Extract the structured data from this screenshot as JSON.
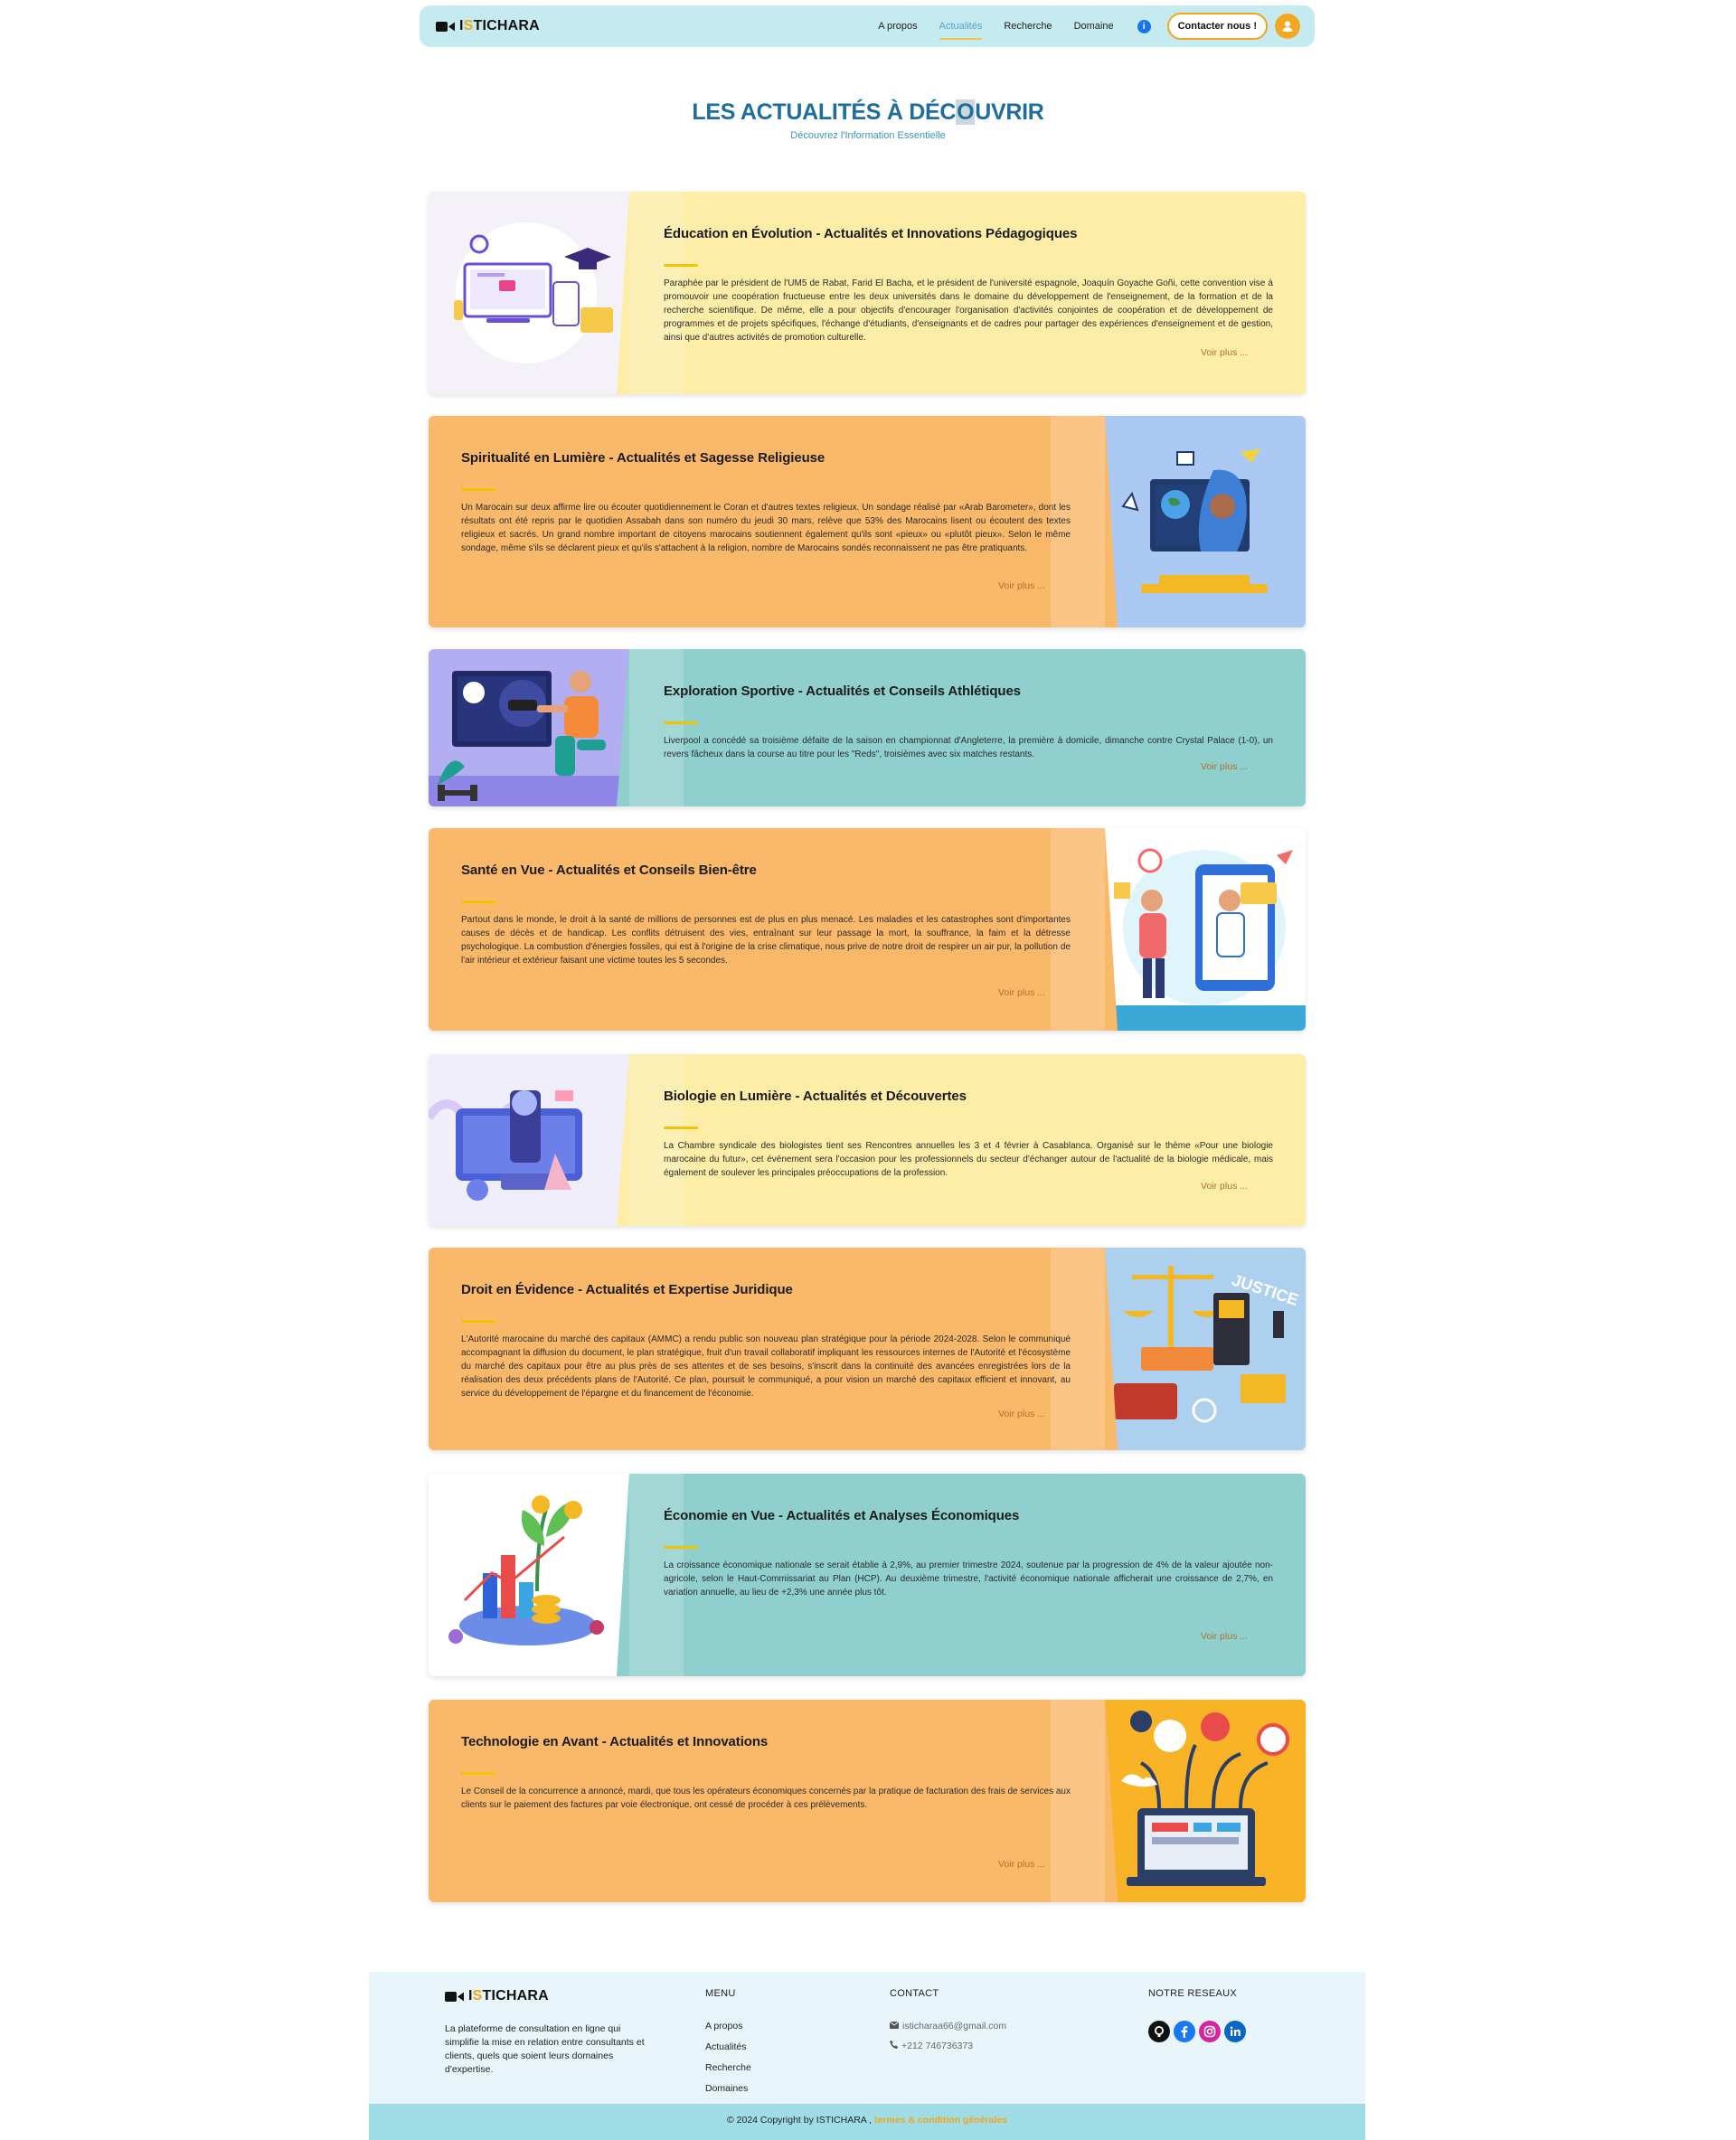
{
  "brand": {
    "prefix": "I",
    "accent": "S",
    "rest": "TICHARA"
  },
  "nav": {
    "links": [
      "A propos",
      "Actualités",
      "Recherche",
      "Domaine"
    ],
    "active_index": 1,
    "info_label": "i",
    "contact_label": "Contacter nous !"
  },
  "header": {
    "title_before": "LES ACTUALITÉS À DÉC",
    "title_highlight": "O",
    "title_after": "UVRIR",
    "subtitle": "Découvrez l'Information Essentielle"
  },
  "cards": [
    {
      "title": "Éducation en Évolution - Actualités et Innovations Pédagogiques",
      "body": "Paraphée par le président de l'UM5 de Rabat, Farid El Bacha, et le président de l'université espagnole, Joaquín Goyache Goñi, cette convention vise à promouvoir une coopération fructueuse entre les deux universités dans le domaine du développement de l'enseignement, de la formation et de la recherche scientifique. De même, elle a pour objectifs d'encourager l'organisation d'activités conjointes de coopération et de développement de programmes et de projets spécifiques, l'échange d'étudiants, d'enseignants et de cadres pour partager des expériences d'enseignement et de gestion, ainsi que d'autres activités de promotion culturelle.",
      "more": "Voir plus ...",
      "illustration": "education-icon"
    },
    {
      "title": "Spiritualité en Lumière - Actualités et Sagesse Religieuse",
      "body": "Un Marocain sur deux affirme lire ou écouter quotidiennement le Coran et d'autres textes religieux. Un sondage réalisé par «Arab Barometer», dont les résultats ont été repris par le quotidien Assabah dans son numéro du jeudi 30 mars, relève que 53% des Marocains lisent ou écoutent des textes religieux et sacrés. Un grand nombre important de citoyens marocains soutiennent également qu'ils sont «pieux» ou «plutôt pieux». Selon le même sondage, même s'ils se déclarent pieux et qu'ils s'attachent à la religion, nombre de Marocains sondés reconnaissent ne pas être pratiquants.",
      "more": "Voir plus ...",
      "illustration": "religion-icon"
    },
    {
      "title": "Exploration Sportive - Actualités et Conseils Athlétiques",
      "body": "Liverpool a concédé sa troisième défaite de la saison en championnat d'Angleterre, la première à domicile, dimanche contre Crystal Palace (1-0), un revers fâcheux dans la course au titre pour les \"Reds\", troisièmes avec six matches restants.",
      "more": "Voir plus ...",
      "illustration": "sport-icon"
    },
    {
      "title": "Santé en Vue - Actualités et Conseils Bien-être",
      "body": "Partout dans le monde, le droit à la santé de millions de personnes est de plus en plus menacé. Les maladies et les catastrophes sont d'importantes causes de décès et de handicap. Les conflits détruisent des vies, entraînant sur leur passage la mort, la souffrance, la faim et la détresse psychologique. La combustion d'énergies fossiles, qui est à l'origine de la crise climatique, nous prive de notre droit de respirer un air pur, la pollution de l'air intérieur et extérieur faisant une victime toutes les 5 secondes.",
      "more": "Voir plus ...",
      "illustration": "health-icon"
    },
    {
      "title": "Biologie en Lumière - Actualités et Découvertes",
      "body": "La Chambre syndicale des biologistes tient ses Rencontres annuelles les 3 et 4 février à Casablanca. Organisé sur le thème «Pour une biologie marocaine du futur», cet événement sera l'occasion pour les professionnels du secteur d'échanger autour de l'actualité de la biologie médicale, mais également de soulever les principales préoccupations de la profession.",
      "more": "Voir plus ...",
      "illustration": "biology-icon"
    },
    {
      "title": "Droit en Évidence - Actualités et Expertise Juridique",
      "body": "L'Autorité marocaine du marché des capitaux (AMMC) a rendu public son nouveau plan stratégique pour la période 2024-2028. Selon le communiqué accompagnant la diffusion du document, le plan stratégique, fruit d'un travail collaboratif impliquant les ressources internes de l'Autorité et l'écosystème du marché des capitaux pour être au plus près de ses attentes et de ses besoins, s'inscrit dans la continuité des avancées enregistrées lors de la réalisation des deux précédents plans de l'Autorité. Ce plan, poursuit le communiqué, a pour vision un marché des capitaux efficient et innovant, au service du développement de l'épargne et du financement de l'économie.",
      "more": "Voir plus ...",
      "illustration": "justice-icon",
      "illustration_text": "JUSTICE"
    },
    {
      "title": "Économie en Vue - Actualités et Analyses Économiques",
      "body": "La croissance économique nationale se serait établie à 2,9%, au premier trimestre 2024, soutenue par la progression de 4% de la valeur ajoutée non-agricole, selon le Haut-Commissariat au Plan (HCP). Au deuxième trimestre, l'activité économique nationale afficherait une croissance de 2,7%, en variation annuelle, au lieu de +2,3% une année plus tôt.",
      "more": "Voir plus ...",
      "illustration": "economy-icon"
    },
    {
      "title": "Technologie en Avant - Actualités et Innovations",
      "body": "Le Conseil de la concurrence a annoncé, mardi, que tous les opérateurs économiques concernés par la pratique de facturation des frais de services aux clients sur le paiement des factures par voie électronique, ont cessé de procéder à ces prélèvements.",
      "more": "Voir plus ...",
      "illustration": "technology-icon"
    }
  ],
  "footer": {
    "description": "La plateforme de consultation en ligne qui simplifie la mise en relation entre consultants et clients, quels que soient leurs domaines d'expertise.",
    "menu_heading": "MENU",
    "menu_links": [
      "A propos",
      "Actualités",
      "Recherche",
      "Domaines"
    ],
    "contact_heading": "CONTACT",
    "email": "isticharaa66@gmail.com",
    "phone": "+212 746736373",
    "social_heading": "NOTRE RESEAUX",
    "socials": [
      "github-icon",
      "facebook-icon",
      "instagram-icon",
      "linkedin-icon"
    ],
    "copyright": "© 2024 Copyright by ISTICHARA ,",
    "terms": "termes & condition générales"
  },
  "colors": {
    "navbar": "#c5eaef",
    "accent": "#f2a51a",
    "title": "#1f6e9a",
    "card_yellow": "#fdeda6",
    "card_orange": "#f9b86a",
    "card_teal": "#8fcfcd",
    "footer": "#e8f6fb",
    "copybar": "#9fdde6"
  }
}
